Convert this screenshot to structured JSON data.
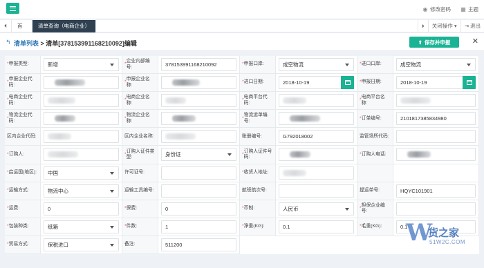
{
  "topbar": {
    "change_password": "修改密码",
    "theme": "主题"
  },
  "tabs": {
    "home": "首页",
    "active": "清单查询（电商企业）",
    "close_ops": "关闭操作",
    "logout": "退出"
  },
  "header": {
    "breadcrumb_link": "清单列表",
    "breadcrumb_rest": " > 清单[378153991168210092]编辑",
    "save_button": "保存并申报"
  },
  "colors": {
    "accent": "#1ab394",
    "tab_active": "#2f4050",
    "link": "#337ab7",
    "required": "#ed5565"
  },
  "form": {
    "rows": [
      [
        {
          "label": "申报类型:",
          "required": true,
          "kind": "select",
          "value": "新增"
        },
        {
          "label": "企业内部编号:",
          "required": true,
          "kind": "text",
          "value": "378153991168210092"
        },
        {
          "label": "申报口岸:",
          "required": true,
          "kind": "select",
          "value": "成空物流"
        },
        {
          "label": "进口口岸:",
          "required": true,
          "kind": "select",
          "value": "成空物流"
        }
      ],
      [
        {
          "label": "申报企业代码:",
          "required": true,
          "kind": "blur"
        },
        {
          "label": "申报企业名称:",
          "required": true,
          "kind": "blur"
        },
        {
          "label": "进口日期:",
          "required": true,
          "kind": "date",
          "value": "2018-10-19"
        },
        {
          "label": "申报日期:",
          "required": true,
          "kind": "date",
          "value": "2018-10-19"
        }
      ],
      [
        {
          "label": "电商企业代码:",
          "required": true,
          "kind": "blurlight"
        },
        {
          "label": "电商企业名称:",
          "required": true,
          "kind": "blurlight"
        },
        {
          "label": "电商平台代码:",
          "required": true,
          "kind": "blurlight"
        },
        {
          "label": "电商平台名称:",
          "required": true,
          "kind": "blurlight"
        }
      ],
      [
        {
          "label": "物流企业代码:",
          "required": true,
          "kind": "blur"
        },
        {
          "label": "物流企业名称:",
          "required": true,
          "kind": "blur"
        },
        {
          "label": "物流运单编号:",
          "required": true,
          "kind": "blur"
        },
        {
          "label": "订单编号:",
          "required": true,
          "kind": "text",
          "value": "2101817385834980"
        }
      ],
      [
        {
          "label": "区内企业代码:",
          "required": false,
          "kind": "blurlight"
        },
        {
          "label": "区内企业名称:",
          "required": false,
          "kind": "blurlight"
        },
        {
          "label": "账册编号:",
          "required": false,
          "kind": "text",
          "value": "G792018002"
        },
        {
          "label": "监管场所代码:",
          "required": false,
          "kind": "empty"
        }
      ],
      [
        {
          "label": "订购人:",
          "required": true,
          "kind": "blurlight"
        },
        {
          "label": "订购人证件类型:",
          "required": true,
          "kind": "select",
          "value": "身份证"
        },
        {
          "label": "订购人证件号码:",
          "required": true,
          "kind": "blur"
        },
        {
          "label": "订购人电话:",
          "required": true,
          "kind": "blur"
        }
      ],
      [
        {
          "label": "启运国(地区):",
          "required": true,
          "kind": "select",
          "value": "中国"
        },
        {
          "label": "许可证号:",
          "required": false,
          "kind": "empty"
        },
        {
          "label": "收货人地址:",
          "required": true,
          "kind": "blurlight"
        },
        {
          "label": "",
          "required": false,
          "kind": "none"
        }
      ],
      [
        {
          "label": "运输方式:",
          "required": true,
          "kind": "select",
          "value": "物流中心"
        },
        {
          "label": "运输工具编号:",
          "required": false,
          "kind": "empty"
        },
        {
          "label": "航班航次号:",
          "required": false,
          "kind": "empty"
        },
        {
          "label": "提运单号:",
          "required": false,
          "kind": "text",
          "value": "HQYC101901"
        }
      ],
      [
        {
          "label": "运费:",
          "required": true,
          "kind": "text",
          "value": "0"
        },
        {
          "label": "保费:",
          "required": true,
          "kind": "text",
          "value": "0"
        },
        {
          "label": "币制:",
          "required": true,
          "kind": "select",
          "value": "人民币"
        },
        {
          "label": "担保企业编号:",
          "required": true,
          "kind": "empty"
        }
      ],
      [
        {
          "label": "包装种类:",
          "required": true,
          "kind": "select",
          "value": "纸箱"
        },
        {
          "label": "件数:",
          "required": true,
          "kind": "text",
          "value": "1"
        },
        {
          "label": "净重(KG):",
          "required": true,
          "kind": "text",
          "value": "0.1"
        },
        {
          "label": "毛重(KG):",
          "required": true,
          "kind": "text",
          "value": "0.1"
        }
      ],
      [
        {
          "label": "贸易方式:",
          "required": true,
          "kind": "select",
          "value": "保税进口"
        },
        {
          "label": "备注:",
          "required": false,
          "kind": "text",
          "value": "511200"
        },
        {
          "label": "",
          "required": false,
          "kind": "hidden"
        },
        {
          "label": "",
          "required": false,
          "kind": "hidden"
        }
      ]
    ]
  },
  "watermark": {
    "logo_text": "货之家",
    "url": "51W2C.COM"
  }
}
